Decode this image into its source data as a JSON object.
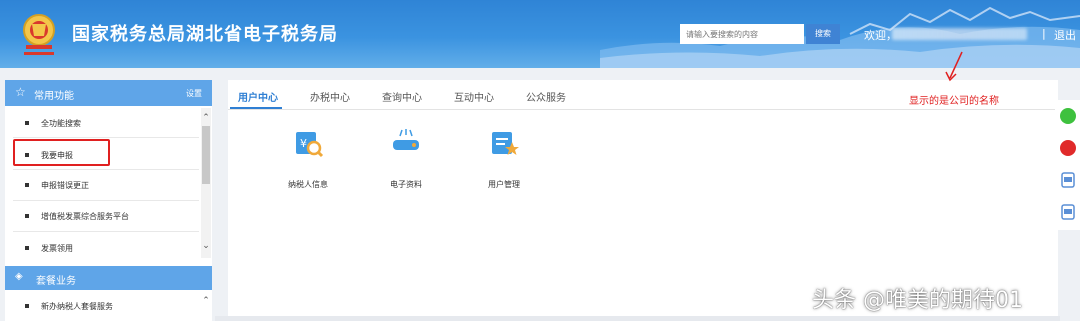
{
  "header": {
    "title": "国家税务总局湖北省电子税务局",
    "search_placeholder": "请输入要搜索的内容",
    "search_button": "搜索",
    "welcome": "欢迎，",
    "separator": "|",
    "logout": "退出"
  },
  "sidebar": {
    "common_title": "常用功能",
    "settings": "设置",
    "items": [
      {
        "label": "全功能搜索"
      },
      {
        "label": "我要申报"
      },
      {
        "label": "申报错误更正"
      },
      {
        "label": "增值税发票综合服务平台"
      },
      {
        "label": "发票领用"
      }
    ],
    "package_title": "套餐业务",
    "package_items": [
      {
        "label": "新办纳税人套餐服务"
      }
    ]
  },
  "main": {
    "tabs": [
      {
        "label": "用户中心",
        "active": true
      },
      {
        "label": "办税中心"
      },
      {
        "label": "查询中心"
      },
      {
        "label": "互动中心"
      },
      {
        "label": "公众服务"
      }
    ],
    "annotation": "显示的是公司的名称",
    "functions": [
      {
        "label": "纳税人信息",
        "icon": "taxpayer-info-icon"
      },
      {
        "label": "电子资料",
        "icon": "electronic-docs-icon"
      },
      {
        "label": "用户管理",
        "icon": "user-management-icon"
      }
    ]
  },
  "float_icons": [
    "wechat-icon",
    "weibo-icon",
    "app-icon",
    "app-icon"
  ],
  "watermark": "头条 @唯美的期待01",
  "colors": {
    "header_blue": "#3b8fdc",
    "accent_blue": "#2f7fd3",
    "sidebar_head": "#5fa5e8",
    "highlight_red": "#e02020"
  }
}
